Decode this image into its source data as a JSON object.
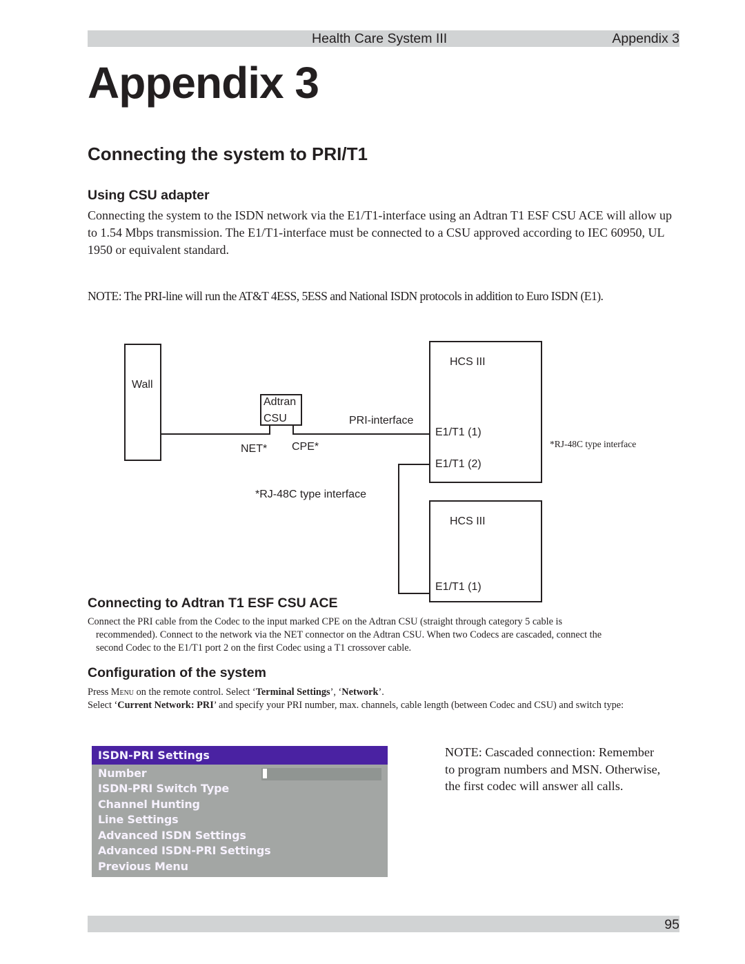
{
  "header": {
    "title": "Health Care System III",
    "section": "Appendix 3"
  },
  "page_title": "Appendix 3",
  "section_title": "Connecting the system to PRI/T1",
  "csu_section": {
    "heading": "Using CSU adapter",
    "paragraph": "Connecting the system to the ISDN network via the E1/T1-interface using an Adtran T1 ESF CSU ACE  will allow up to 1.54 Mbps transmission. The E1/T1-interface must be connected to a CSU approved according to IEC 60950, UL 1950 or equivalent standard.",
    "note": "NOTE:  The PRI-line will run the AT&T 4ESS, 5ESS and National ISDN protocols in addition to Euro ISDN (E1)."
  },
  "diagram": {
    "wall_label": "Wall",
    "csu_label_line1": "Adtran",
    "csu_label_line2": "CSU",
    "net_label": "NET*",
    "cpe_label": "CPE*",
    "pri_interface_label": "PRI-interface",
    "rj48c_note_center": "*RJ-48C type interface",
    "rj48c_note_right": "*RJ-48C type interface",
    "hcs_top": {
      "title": "HCS III",
      "port1": "E1/T1 (1)",
      "port2": "E1/T1 (2)"
    },
    "hcs_bottom": {
      "title": "HCS III",
      "port1": "E1/T1 (1)"
    }
  },
  "adtran_section": {
    "heading": "Connecting to Adtran T1 ESF CSU ACE",
    "paragraph_line1": "Connect the PRI cable from the Codec to the input marked CPE on the Adtran CSU (straight through category 5 cable is",
    "paragraph_line2": "recommended). Connect to the network via the NET connector on the Adtran CSU. When two Codecs are cascaded, connect the",
    "paragraph_line3": "second Codec to the E1/T1 port 2 on the first Codec using a T1 crossover cable."
  },
  "config_section": {
    "heading": "Configuration of the system",
    "line1_prefix": "Press ",
    "line1_menu": "Menu",
    "line1_mid": "  on the remote control. Select ‘",
    "line1_bold1": "Terminal Settings",
    "line1_sep": "’, ‘",
    "line1_bold2": "Network",
    "line1_end": "’.",
    "line2_prefix": "Select ‘",
    "line2_bold": "Current Network: PRI",
    "line2_rest": "’ and specify your PRI number, max. channels, cable length (between Codec and CSU) and switch type:"
  },
  "menu": {
    "title": "ISDN-PRI Settings",
    "number_value": "",
    "items": [
      "Number",
      "ISDN-PRI Switch Type",
      "Channel Hunting",
      "Line Settings",
      "Advanced ISDN Settings",
      "Advanced ISDN-PRI Settings",
      "Previous Menu"
    ],
    "colors": {
      "header_bg": "#4a22a2",
      "body_bg": "#a3a6a4",
      "text": "#f7f2ff"
    }
  },
  "cascade_note": "NOTE:  Cascaded connection: Remember to program numbers and MSN. Otherwise, the first codec will answer all calls.",
  "footer": {
    "page_number": "95"
  }
}
